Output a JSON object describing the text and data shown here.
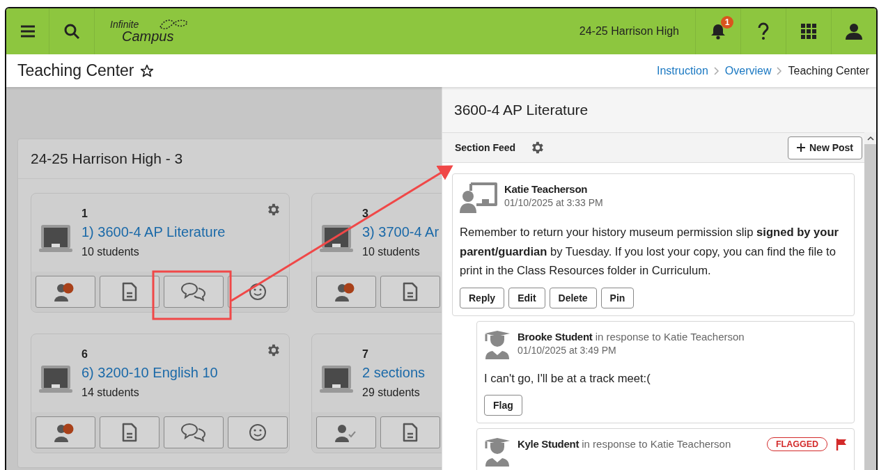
{
  "header": {
    "logo": {
      "line1": "Infinite",
      "line2": "Campus"
    },
    "school": "24-25 Harrison High",
    "notifications": "1"
  },
  "page": {
    "title": "Teaching Center",
    "favorite": false,
    "breadcrumbs": [
      {
        "label": "Instruction",
        "link": true
      },
      {
        "label": "Overview",
        "link": true
      },
      {
        "label": "Teaching Center",
        "link": false
      }
    ]
  },
  "calendar": {
    "title": "24-25 Harrison High - 3",
    "tiles": [
      {
        "period": "1",
        "title": "1) 3600-4 AP Literature",
        "students": "10 students",
        "settings": true,
        "buttons": [
          {
            "kind": "roster-alert"
          },
          {
            "kind": "document"
          },
          {
            "kind": "chat"
          },
          {
            "kind": "smiley"
          }
        ]
      },
      {
        "period": "3",
        "title": "3) 3700-4 Ar",
        "students": "10 students",
        "settings": false,
        "buttons": [
          {
            "kind": "roster-alert"
          },
          {
            "kind": "document"
          }
        ]
      },
      {
        "period": "6",
        "title": "6) 3200-10 English 10",
        "students": "14 students",
        "settings": true,
        "buttons": [
          {
            "kind": "roster-alert"
          },
          {
            "kind": "document"
          },
          {
            "kind": "chat"
          },
          {
            "kind": "smiley"
          }
        ]
      },
      {
        "period": "7",
        "title": "2 sections",
        "students": "29 students",
        "settings": false,
        "buttons": [
          {
            "kind": "roster-check"
          },
          {
            "kind": "document"
          }
        ]
      }
    ]
  },
  "panel": {
    "title": "3600-4 AP Literature",
    "feed_title": "Section Feed",
    "new_post": "New Post",
    "posts": [
      {
        "kind": "teacher",
        "author": "Katie Teacherson",
        "time": "01/10/2025 at 3:33 PM",
        "body": "Remember to return your history museum permission slip **signed by your parent/guardian** by Tuesday. If you lost your copy, you can find the file to print in the Class Resources folder in Curriculum.",
        "flagged": false,
        "buttons": [
          "Reply",
          "Edit",
          "Delete",
          "Pin"
        ],
        "children": [
          {
            "kind": "student",
            "author": "Brooke Student",
            "response": "in response to Katie Teacherson",
            "time": "01/10/2025 at 3:49 PM",
            "body": "I can't go, I'll be at a track meet:(",
            "flagged": false,
            "buttons": [
              "Flag"
            ]
          },
          {
            "kind": "student",
            "author": "Kyle Student",
            "response": "in response to Katie Teacherson",
            "badge": "FLAGGED",
            "flagged": true
          }
        ]
      }
    ]
  }
}
